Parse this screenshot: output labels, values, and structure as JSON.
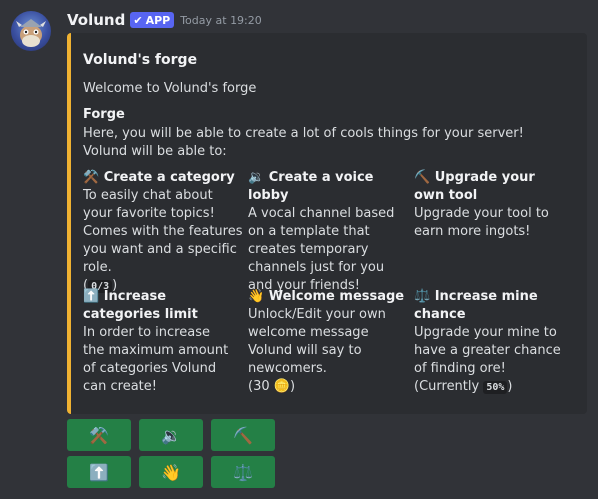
{
  "message": {
    "username": "Volund",
    "badge": "APP",
    "timestamp": "Today at 19:20"
  },
  "embed": {
    "accent_color": "#f0b232",
    "title": "Volund's forge",
    "description": "Welcome to Volund's forge",
    "section_title": "Forge",
    "section_text": "Here, you will be able to create a lot of cools things for your server! Volund will be able to:",
    "fields": [
      {
        "icon": "⚒️",
        "name": "Create a category",
        "value": "To easily chat about your favorite topics! Comes with the features you want and a specific role.",
        "counter": "0/3"
      },
      {
        "icon": "🔉",
        "name": "Create a voice lobby",
        "value": "A vocal channel based on a template that creates temporary channels just for you and your friends!"
      },
      {
        "icon": "⛏️",
        "name": "Upgrade your own tool",
        "value": "Upgrade your tool to earn more ingots!"
      },
      {
        "icon": "⬆️",
        "name": "Increase categories limit",
        "value": "In order to increase the maximum amount of categories Volund can create!"
      },
      {
        "icon": "👋",
        "name": "Welcome message",
        "value": "Unlock/Edit your own welcome message Volund will say to newcomers.",
        "cost_prefix": "(30 ",
        "cost_icon": "🪙",
        "cost_suffix": ")"
      },
      {
        "icon": "⚖️",
        "name": "Increase mine chance",
        "value": "Upgrade your mine to have a greater chance of finding ore!",
        "extra_prefix": "(Currently ",
        "extra_code": "50%",
        "extra_suffix": ")"
      }
    ]
  },
  "buttons": {
    "color": "#248046",
    "row1": [
      "⚒️",
      "🔉",
      "⛏️"
    ],
    "row2": [
      "⬆️",
      "👋",
      "⚖️"
    ]
  }
}
